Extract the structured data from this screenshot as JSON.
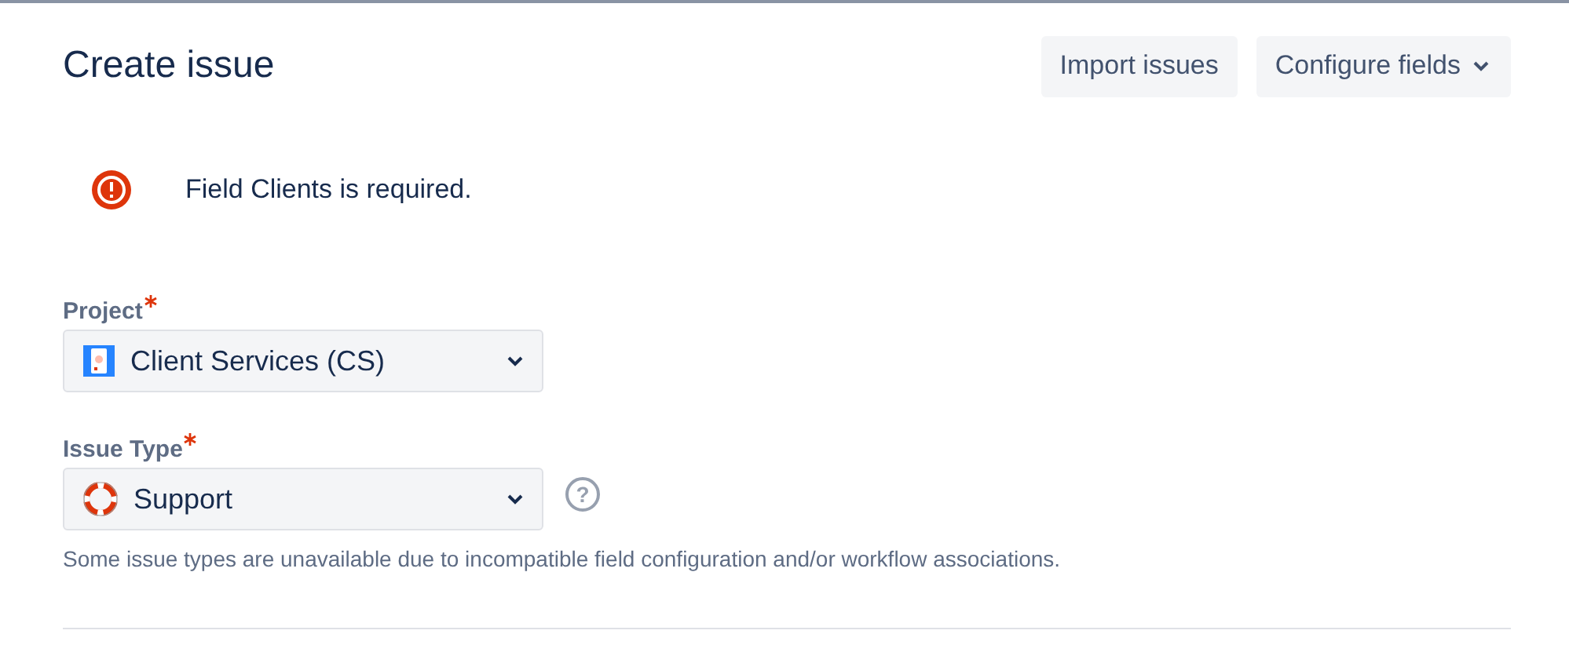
{
  "dialog": {
    "title": "Create issue"
  },
  "actions": [
    {
      "label": "Import issues",
      "kind": "plain"
    },
    {
      "label": "Configure fields",
      "kind": "dropdown"
    }
  ],
  "error": {
    "message": "Field Clients is required."
  },
  "fields": [
    {
      "label": "Project",
      "required": true,
      "value": "Client Services (CS)",
      "kind": "project"
    },
    {
      "label": "Issue Type",
      "required": true,
      "value": "Support",
      "kind": "issuetype",
      "help_icon": "?"
    }
  ],
  "note": "Some issue types are unavailable due to incompatible field configuration and/or workflow associations."
}
